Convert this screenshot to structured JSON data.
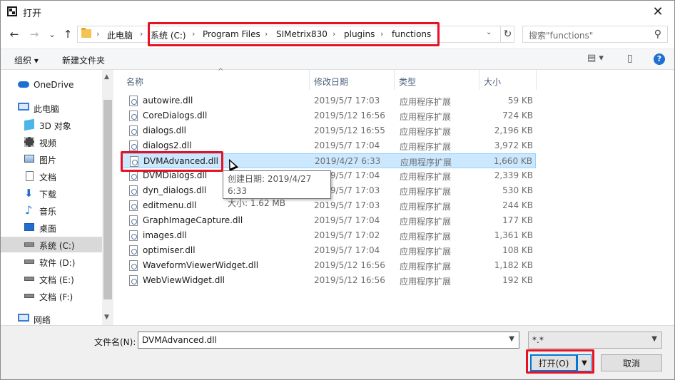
{
  "window": {
    "title": "打开",
    "close_symbol": "✕"
  },
  "nav": {
    "back": "←",
    "forward": "→",
    "recent": "⌄",
    "up": "↑"
  },
  "breadcrumb": {
    "root": "此电脑",
    "items": [
      "系统 (C:)",
      "Program Files",
      "SIMetrix830",
      "plugins",
      "functions"
    ],
    "separator": "›",
    "refresh": "↻",
    "dropdown": "⌄"
  },
  "search": {
    "placeholder": "搜索\"functions\"",
    "icon": "⚲"
  },
  "toolbar": {
    "organize": "组织 ▾",
    "new_folder": "新建文件夹",
    "view_icon": "▤ ▾",
    "pane_icon": "▯",
    "help": "?"
  },
  "sidebar": {
    "items": [
      {
        "label": "OneDrive",
        "icon": "cloud-icon"
      },
      {
        "label": "此电脑",
        "icon": "computer-icon"
      },
      {
        "label": "3D 对象",
        "icon": "cube-icon"
      },
      {
        "label": "视频",
        "icon": "video-icon"
      },
      {
        "label": "图片",
        "icon": "picture-icon"
      },
      {
        "label": "文档",
        "icon": "document-icon"
      },
      {
        "label": "下载",
        "icon": "download-icon"
      },
      {
        "label": "音乐",
        "icon": "music-icon"
      },
      {
        "label": "桌面",
        "icon": "desktop-icon"
      },
      {
        "label": "系统 (C:)",
        "icon": "drive-icon"
      },
      {
        "label": "软件 (D:)",
        "icon": "drive-icon"
      },
      {
        "label": "文档 (E:)",
        "icon": "drive-icon"
      },
      {
        "label": "文档 (F:)",
        "icon": "drive-icon"
      },
      {
        "label": "网络",
        "icon": "network-icon"
      }
    ],
    "selected_index": 9
  },
  "columns": {
    "name": "名称",
    "date": "修改日期",
    "type": "类型",
    "size": "大小"
  },
  "files": [
    {
      "name": "autowire.dll",
      "date": "2019/5/7 17:03",
      "type": "应用程序扩展",
      "size": "59 KB"
    },
    {
      "name": "CoreDialogs.dll",
      "date": "2019/5/12 16:56",
      "type": "应用程序扩展",
      "size": "724 KB"
    },
    {
      "name": "dialogs.dll",
      "date": "2019/5/12 16:55",
      "type": "应用程序扩展",
      "size": "2,196 KB"
    },
    {
      "name": "dialogs2.dll",
      "date": "2019/5/7 17:04",
      "type": "应用程序扩展",
      "size": "3,972 KB"
    },
    {
      "name": "DVMAdvanced.dll",
      "date": "2019/4/27 6:33",
      "type": "应用程序扩展",
      "size": "1,660 KB"
    },
    {
      "name": "DVMDialogs.dll",
      "date": "2019/5/7 17:04",
      "type": "应用程序扩展",
      "size": "2,339 KB"
    },
    {
      "name": "dyn_dialogs.dll",
      "date": "2019/5/7 17:03",
      "type": "应用程序扩展",
      "size": "530 KB"
    },
    {
      "name": "editmenu.dll",
      "date": "2019/5/7 17:03",
      "type": "应用程序扩展",
      "size": "244 KB"
    },
    {
      "name": "GraphImageCapture.dll",
      "date": "2019/5/7 17:04",
      "type": "应用程序扩展",
      "size": "177 KB"
    },
    {
      "name": "images.dll",
      "date": "2019/5/7 17:02",
      "type": "应用程序扩展",
      "size": "1,361 KB"
    },
    {
      "name": "optimiser.dll",
      "date": "2019/5/7 17:04",
      "type": "应用程序扩展",
      "size": "108 KB"
    },
    {
      "name": "WaveformViewerWidget.dll",
      "date": "2019/5/12 16:56",
      "type": "应用程序扩展",
      "size": "1,182 KB"
    },
    {
      "name": "WebViewWidget.dll",
      "date": "2019/5/12 16:56",
      "type": "应用程序扩展",
      "size": "192 KB"
    }
  ],
  "selected_file_index": 4,
  "tooltip": {
    "created": "创建日期: 2019/4/27 6:33",
    "size": "大小: 1.62 MB"
  },
  "bottom": {
    "filename_label": "文件名(N):",
    "filename_value": "DVMAdvanced.dll",
    "filter_value": "*.*",
    "open_label": "打开(O)",
    "cancel_label": "取消"
  },
  "colors": {
    "highlight": "#e81123",
    "selection": "#cce8ff",
    "accent": "#0078d7"
  }
}
